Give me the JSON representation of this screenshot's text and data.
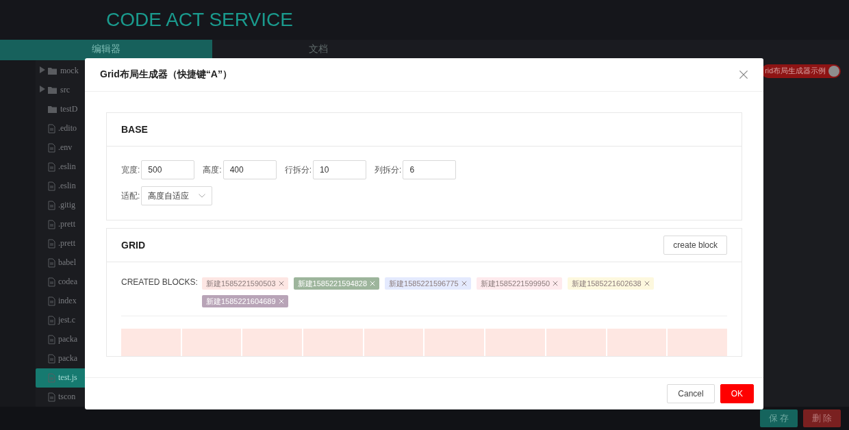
{
  "app": {
    "title": "CODE ACT SERVICE"
  },
  "tabs": [
    {
      "label": "编辑器",
      "selected": true
    },
    {
      "label": "文档",
      "selected": false
    }
  ],
  "file_tree": [
    {
      "name": "mock",
      "kind": "folder",
      "expanded": false,
      "selected": false
    },
    {
      "name": "src",
      "kind": "folder",
      "expanded": false,
      "selected": false
    },
    {
      "name": "testD",
      "kind": "folder",
      "selected": false
    },
    {
      "name": ".edito",
      "kind": "file",
      "selected": false
    },
    {
      "name": ".env",
      "kind": "file",
      "selected": false
    },
    {
      "name": ".eslin",
      "kind": "file",
      "selected": false
    },
    {
      "name": ".eslin",
      "kind": "file",
      "selected": false
    },
    {
      "name": ".gitig",
      "kind": "file",
      "selected": false
    },
    {
      "name": ".prett",
      "kind": "file",
      "selected": false
    },
    {
      "name": ".prett",
      "kind": "file",
      "selected": false
    },
    {
      "name": "babel",
      "kind": "file",
      "selected": false
    },
    {
      "name": "codea",
      "kind": "file",
      "selected": false
    },
    {
      "name": "index",
      "kind": "file",
      "selected": false
    },
    {
      "name": "jest.c",
      "kind": "file",
      "selected": false
    },
    {
      "name": "packa",
      "kind": "file",
      "selected": false
    },
    {
      "name": "packa",
      "kind": "file",
      "selected": false
    },
    {
      "name": "test.js",
      "kind": "file",
      "selected": true
    },
    {
      "name": "tscon",
      "kind": "file",
      "selected": false
    }
  ],
  "example_toggle": {
    "label": "rid布局生成器示例",
    "on": true
  },
  "actions": [
    "保 存",
    "删 除"
  ],
  "dialog": {
    "title": "Grid布局生成器（快捷键“A”）",
    "base": {
      "title": "BASE",
      "fields": [
        {
          "label": "宽度:",
          "value": "500"
        },
        {
          "label": "高度:",
          "value": "400"
        },
        {
          "label": "行拆分:",
          "value": "10"
        },
        {
          "label": "列拆分:",
          "value": "6"
        }
      ],
      "fit": {
        "label": "适配:",
        "value": "高度自适应"
      }
    },
    "grid": {
      "title": "GRID",
      "create_button": "create block",
      "blocks_label": "CREATED BLOCKS:",
      "blocks": [
        {
          "label": "新建1585221590503",
          "color": "#fde6e3"
        },
        {
          "label": "新建1585221594828",
          "color": "#9db59c"
        },
        {
          "label": "新建1585221596775",
          "color": "#e4eafe"
        },
        {
          "label": "新建1585221599950",
          "color": "#feeaed"
        },
        {
          "label": "新建1585221602638",
          "color": "#fdf8de"
        },
        {
          "label": "新建1585221604689",
          "color": "#b8a4b7"
        }
      ]
    },
    "buttons": [
      {
        "label": "Cancel",
        "kind": "default"
      },
      {
        "label": "OK",
        "kind": "primary"
      }
    ]
  }
}
